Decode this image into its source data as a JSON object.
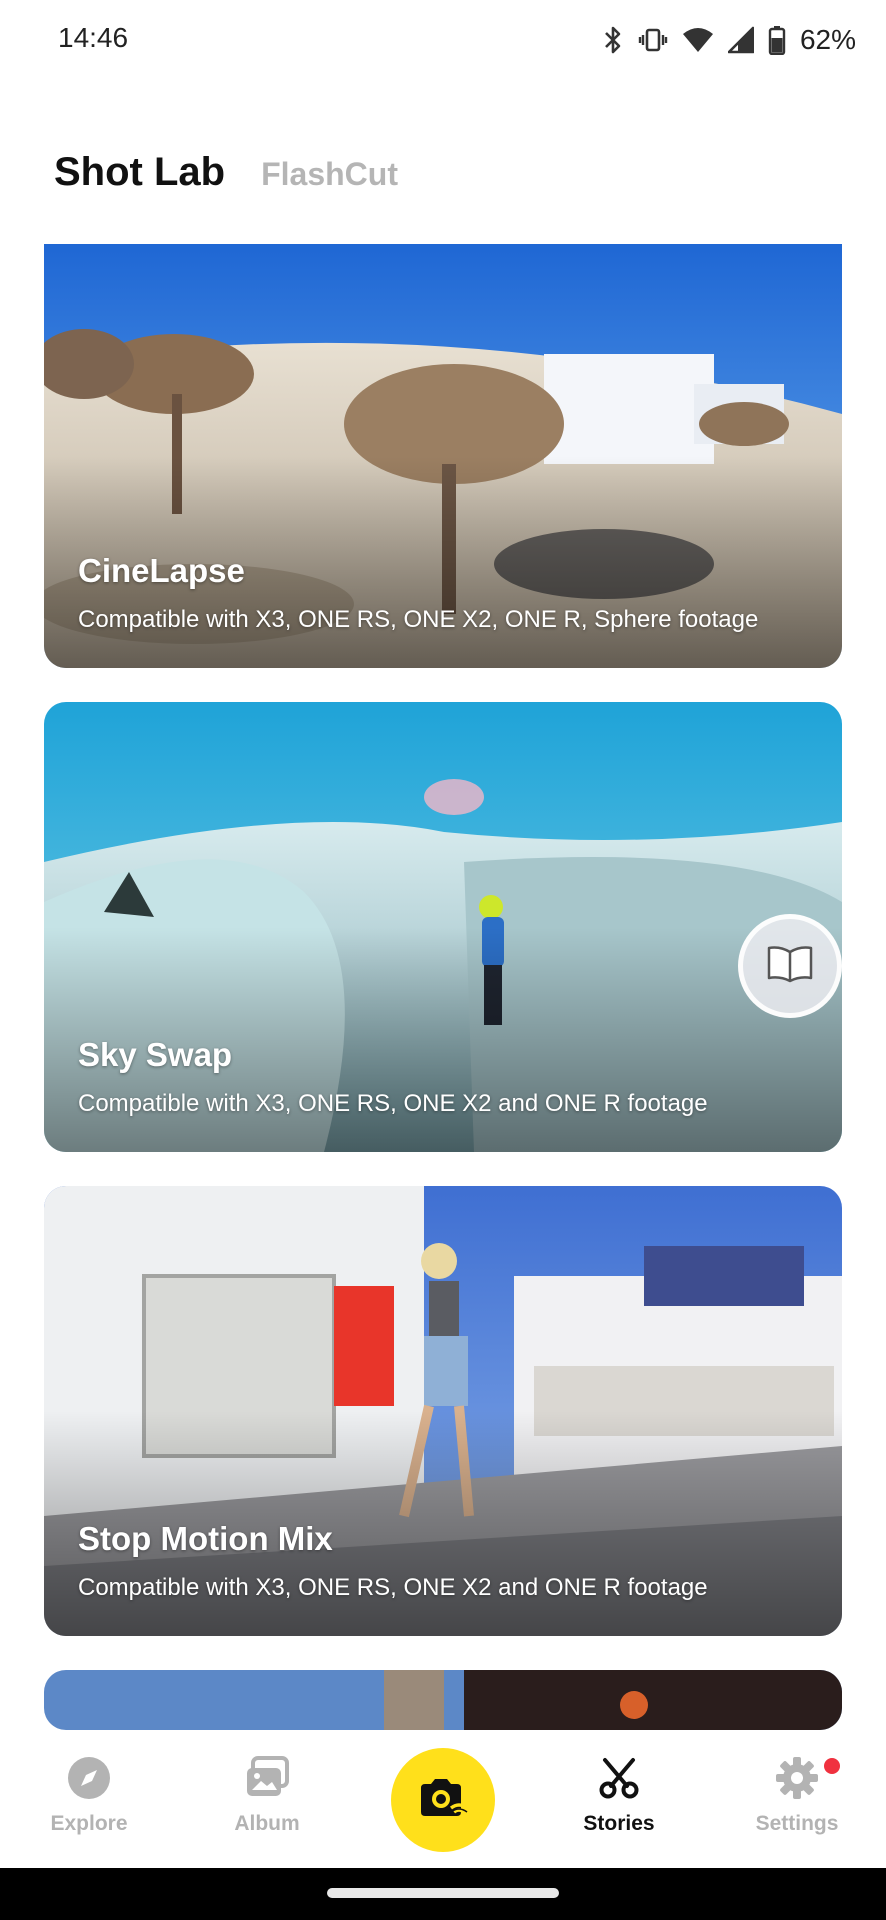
{
  "status_bar": {
    "time": "14:46",
    "battery_percent": "62%",
    "icons": [
      "bluetooth-icon",
      "vibrate-icon",
      "wifi-icon",
      "cell-signal-icon",
      "battery-icon"
    ]
  },
  "header": {
    "tabs": [
      {
        "label": "Shot Lab",
        "active": true
      },
      {
        "label": "FlashCut",
        "active": false
      }
    ]
  },
  "cards": [
    {
      "title": "CineLapse",
      "subtitle": "Compatible with X3, ONE RS, ONE X2, ONE R, Sphere footage"
    },
    {
      "title": "Sky Swap",
      "subtitle": "Compatible with X3, ONE RS, ONE X2 and ONE R footage"
    },
    {
      "title": "Stop Motion Mix",
      "subtitle": "Compatible with X3, ONE RS, ONE X2 and ONE R footage"
    }
  ],
  "bottom_nav": {
    "items": [
      {
        "label": "Explore",
        "icon": "compass-icon",
        "active": false
      },
      {
        "label": "Album",
        "icon": "album-icon",
        "active": false
      },
      {
        "label": "Stories",
        "icon": "scissors-icon",
        "active": true
      },
      {
        "label": "Settings",
        "icon": "gear-icon",
        "active": false
      }
    ],
    "center_icon": "camera-wifi-icon"
  },
  "colors": {
    "accent_yellow": "#ffe01b",
    "notification_red": "#f0313f",
    "inactive_gray": "#b3b3b3"
  }
}
